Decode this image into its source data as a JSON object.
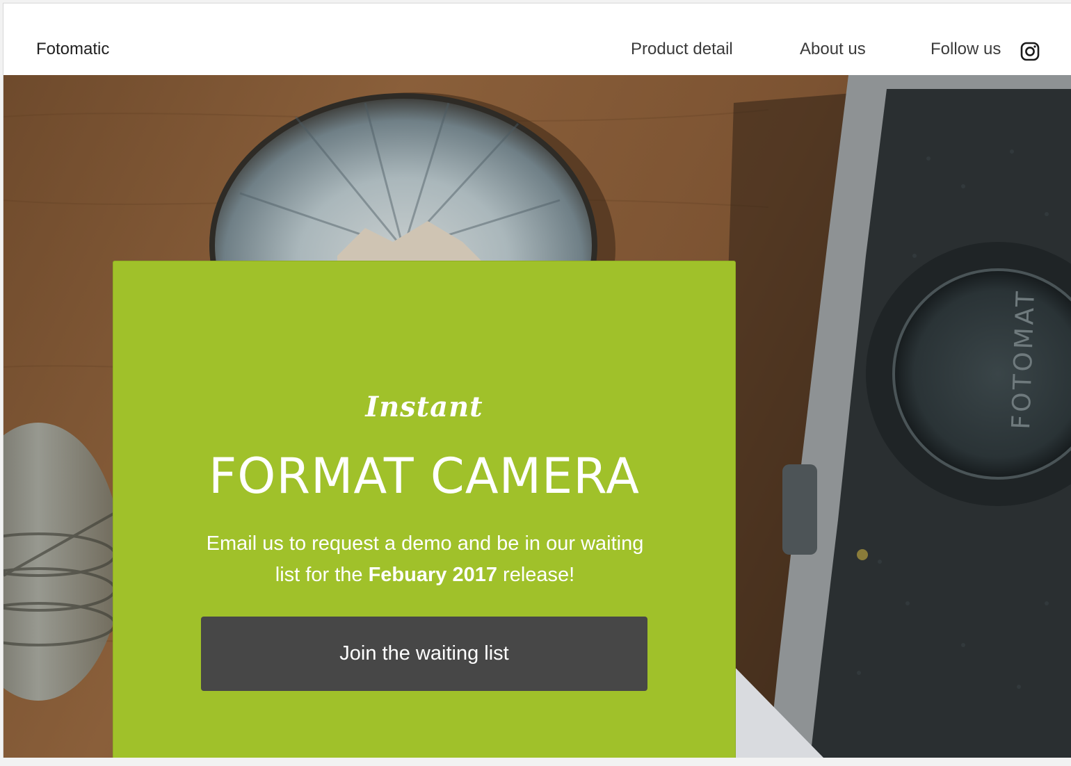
{
  "header": {
    "brand": "Fotomatic",
    "nav": {
      "product_detail": "Product detail",
      "about_us": "About us",
      "follow_us": "Follow us"
    },
    "social_icon": "instagram-icon"
  },
  "hero": {
    "background_image_label": "FOTOMAT",
    "card": {
      "tagline": "Instant",
      "title": "FORMAT CAMERA",
      "description_before": "Email us to request a demo and be in our waiting list for the",
      "description_bold": "Febuary 2017",
      "description_after": "release!",
      "cta_label": "Join the waiting list"
    }
  },
  "colors": {
    "card_green": "#a0c12a",
    "button_dark": "#474747",
    "text_white": "#ffffff"
  }
}
